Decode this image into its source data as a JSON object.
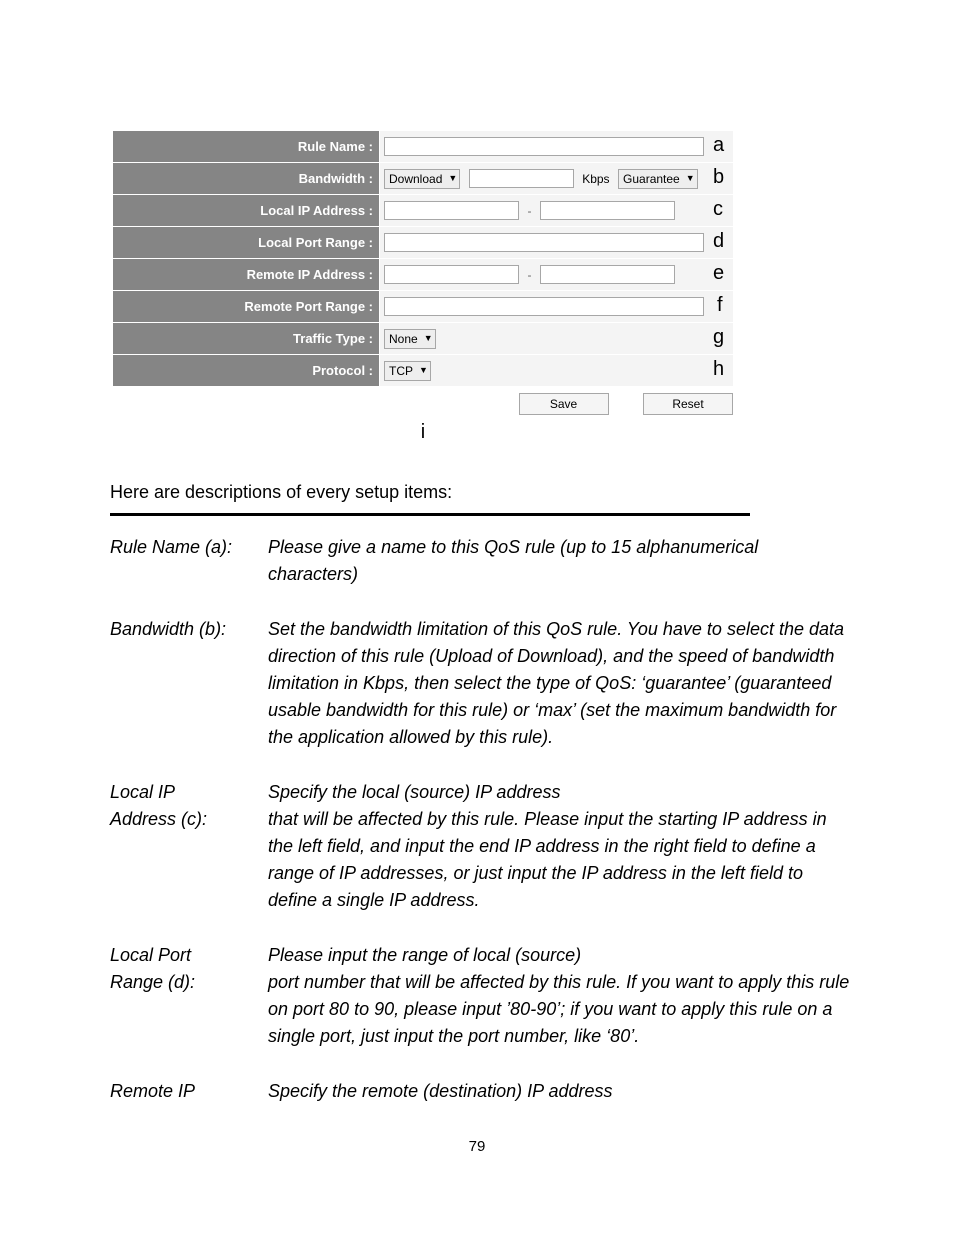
{
  "form": {
    "rows": {
      "rule_name": {
        "label": "Rule Name :",
        "letter": "a"
      },
      "bandwidth": {
        "label": "Bandwidth :",
        "direction_sel": "Download",
        "unit": "Kbps",
        "type_sel": "Guarantee",
        "letter": "b"
      },
      "local_ip": {
        "label": "Local IP Address :",
        "sep": "-",
        "letter": "c"
      },
      "local_port": {
        "label": "Local Port Range :",
        "letter": "d"
      },
      "remote_ip": {
        "label": "Remote IP Address :",
        "sep": "-",
        "letter": "e"
      },
      "remote_port": {
        "label": "Remote Port Range :",
        "letter": "f"
      },
      "traffic_type": {
        "label": "Traffic Type :",
        "sel": "None",
        "letter": "g"
      },
      "protocol": {
        "label": "Protocol :",
        "sel": "TCP",
        "letter": "h"
      }
    },
    "buttons": {
      "save": "Save",
      "reset": "Reset"
    },
    "i_letter": "i"
  },
  "intro": "Here are descriptions of every setup items:",
  "desc": {
    "rule_name": {
      "term": "Rule Name (a):",
      "text": "Please give a name to this QoS rule (up to 15 alphanumerical characters)"
    },
    "bandwidth": {
      "term": "Bandwidth (b):",
      "text": "Set the bandwidth limitation of this QoS rule. You have to select the data direction of this rule (Upload of Download), and the speed of bandwidth limitation in Kbps, then select the type of QoS: ‘guarantee’ (guaranteed usable bandwidth for this rule) or ‘max’ (set the maximum bandwidth for the application allowed by this rule)."
    },
    "local_ip": {
      "term1": "Local IP",
      "term2": "Address (c):",
      "line1": "Specify the local (source) IP address",
      "rest": "that will be affected by this rule. Please input the starting IP address in the left field, and input the end IP address in the right field to define a range of IP addresses, or just input the IP address in the left field to define a single IP address."
    },
    "local_port": {
      "term1": "Local Port",
      "term2": "Range (d):",
      "line1": "Please input the range of local (source)",
      "rest": "port number that will be affected by this rule. If you want to apply this rule on port 80 to 90, please input ’80-90’; if you want to apply this rule on a single port, just input the port number, like ‘80’."
    },
    "remote_ip": {
      "term": "Remote IP",
      "line1": "Specify the remote (destination) IP address"
    }
  },
  "page_number": "79"
}
